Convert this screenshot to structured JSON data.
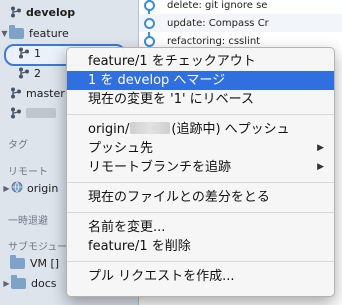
{
  "sidebar": {
    "develop": "develop",
    "feature": "feature",
    "feature_1": "1",
    "feature_2": "2",
    "master": "master",
    "section_tags": "タグ",
    "section_remote": "リモート",
    "remote_origin": "origin",
    "section_stash": "一時退避",
    "section_submodule": "サブモジュール",
    "submodule_vm": "VM []",
    "docs": "docs"
  },
  "commits": [
    "delete: git ignore se",
    "update: Compass Cr",
    "refactoring: csslint"
  ],
  "menu": {
    "item_checkout": "feature/1 をチェックアウト",
    "item_merge": "1 を develop へマージ",
    "item_reset": "現在の変更を '1' にリベース",
    "item_push_prefix": "origin/",
    "item_push_suffix": "(追跡中) へプッシュ",
    "item_push_to": "プッシュ先",
    "item_track": "リモートブランチを追跡",
    "item_diff": "現在のファイルとの差分をとる",
    "item_rename": "名前を変更...",
    "item_delete": "feature/1 を削除",
    "item_pull_request": "プル リクエストを作成..."
  },
  "colors": {
    "accent": "#2f6fe0",
    "graph": "#3a8fd8",
    "sidebar_bg": "#dde4ec"
  }
}
